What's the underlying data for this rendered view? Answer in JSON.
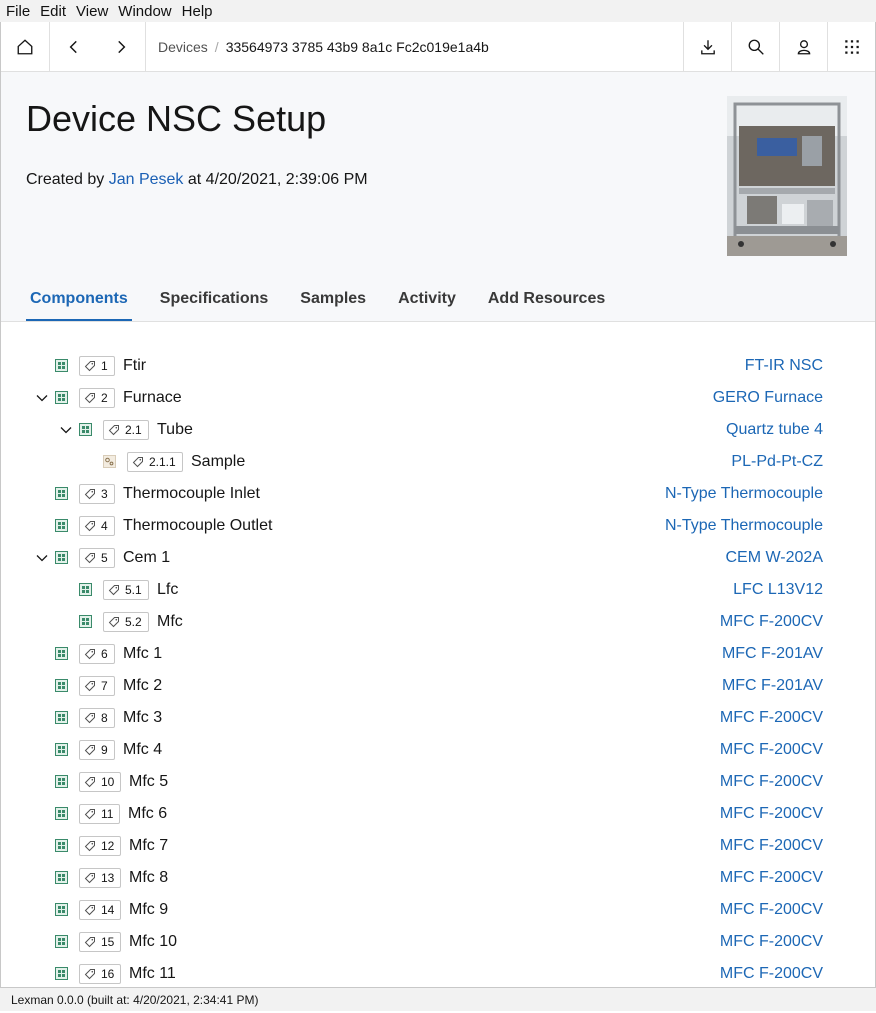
{
  "menubar": {
    "items": [
      "File",
      "Edit",
      "View",
      "Window",
      "Help"
    ]
  },
  "breadcrumb": {
    "parent": "Devices",
    "separator": "/",
    "current": "33564973 3785 43b9 8a1c Fc2c019e1a4b"
  },
  "header": {
    "title": "Device NSC Setup",
    "created_prefix": "Created by",
    "created_user": "Jan Pesek",
    "created_suffix": "at 4/20/2021, 2:39:06 PM"
  },
  "tabs": [
    "Components",
    "Specifications",
    "Samples",
    "Activity",
    "Add Resources"
  ],
  "active_tab": "Components",
  "components": [
    {
      "id": "1",
      "name": "Ftir",
      "type": "FT-IR NSC",
      "level": 0,
      "expanded": null,
      "icon": "grid-icon"
    },
    {
      "id": "2",
      "name": "Furnace",
      "type": "GERO Furnace",
      "level": 0,
      "expanded": true,
      "icon": "grid-icon"
    },
    {
      "id": "2.1",
      "name": "Tube",
      "type": "Quartz tube 4",
      "level": 1,
      "expanded": true,
      "icon": "grid-icon"
    },
    {
      "id": "2.1.1",
      "name": "Sample",
      "type": "PL-Pd-Pt-CZ",
      "level": 2,
      "expanded": null,
      "icon": "sample-icon"
    },
    {
      "id": "3",
      "name": "Thermocouple Inlet",
      "type": "N-Type Thermocouple",
      "level": 0,
      "expanded": null,
      "icon": "grid-icon"
    },
    {
      "id": "4",
      "name": "Thermocouple Outlet",
      "type": "N-Type Thermocouple",
      "level": 0,
      "expanded": null,
      "icon": "grid-icon"
    },
    {
      "id": "5",
      "name": "Cem 1",
      "type": "CEM W-202A",
      "level": 0,
      "expanded": true,
      "icon": "grid-icon"
    },
    {
      "id": "5.1",
      "name": "Lfc",
      "type": "LFC L13V12",
      "level": 1,
      "expanded": null,
      "icon": "grid-icon"
    },
    {
      "id": "5.2",
      "name": "Mfc",
      "type": "MFC F-200CV",
      "level": 1,
      "expanded": null,
      "icon": "grid-icon"
    },
    {
      "id": "6",
      "name": "Mfc 1",
      "type": "MFC F-201AV",
      "level": 0,
      "expanded": null,
      "icon": "grid-icon"
    },
    {
      "id": "7",
      "name": "Mfc 2",
      "type": "MFC F-201AV",
      "level": 0,
      "expanded": null,
      "icon": "grid-icon"
    },
    {
      "id": "8",
      "name": "Mfc 3",
      "type": "MFC F-200CV",
      "level": 0,
      "expanded": null,
      "icon": "grid-icon"
    },
    {
      "id": "9",
      "name": "Mfc 4",
      "type": "MFC F-200CV",
      "level": 0,
      "expanded": null,
      "icon": "grid-icon"
    },
    {
      "id": "10",
      "name": "Mfc 5",
      "type": "MFC F-200CV",
      "level": 0,
      "expanded": null,
      "icon": "grid-icon"
    },
    {
      "id": "11",
      "name": "Mfc 6",
      "type": "MFC F-200CV",
      "level": 0,
      "expanded": null,
      "icon": "grid-icon"
    },
    {
      "id": "12",
      "name": "Mfc 7",
      "type": "MFC F-200CV",
      "level": 0,
      "expanded": null,
      "icon": "grid-icon"
    },
    {
      "id": "13",
      "name": "Mfc 8",
      "type": "MFC F-200CV",
      "level": 0,
      "expanded": null,
      "icon": "grid-icon"
    },
    {
      "id": "14",
      "name": "Mfc 9",
      "type": "MFC F-200CV",
      "level": 0,
      "expanded": null,
      "icon": "grid-icon"
    },
    {
      "id": "15",
      "name": "Mfc 10",
      "type": "MFC F-200CV",
      "level": 0,
      "expanded": null,
      "icon": "grid-icon"
    },
    {
      "id": "16",
      "name": "Mfc 11",
      "type": "MFC F-200CV",
      "level": 0,
      "expanded": null,
      "icon": "grid-icon"
    }
  ],
  "footer": {
    "text": "Lexman 0.0.0 (built at: 4/20/2021, 2:34:41 PM)"
  },
  "colors": {
    "accent": "#1c67b5",
    "grid_icon": "#3a8a6a",
    "header_bg": "#f7f8fa"
  },
  "toolbar_icons": [
    "home-icon",
    "back-icon",
    "forward-icon",
    "download-icon",
    "search-icon",
    "user-icon",
    "app-switcher-icon"
  ]
}
